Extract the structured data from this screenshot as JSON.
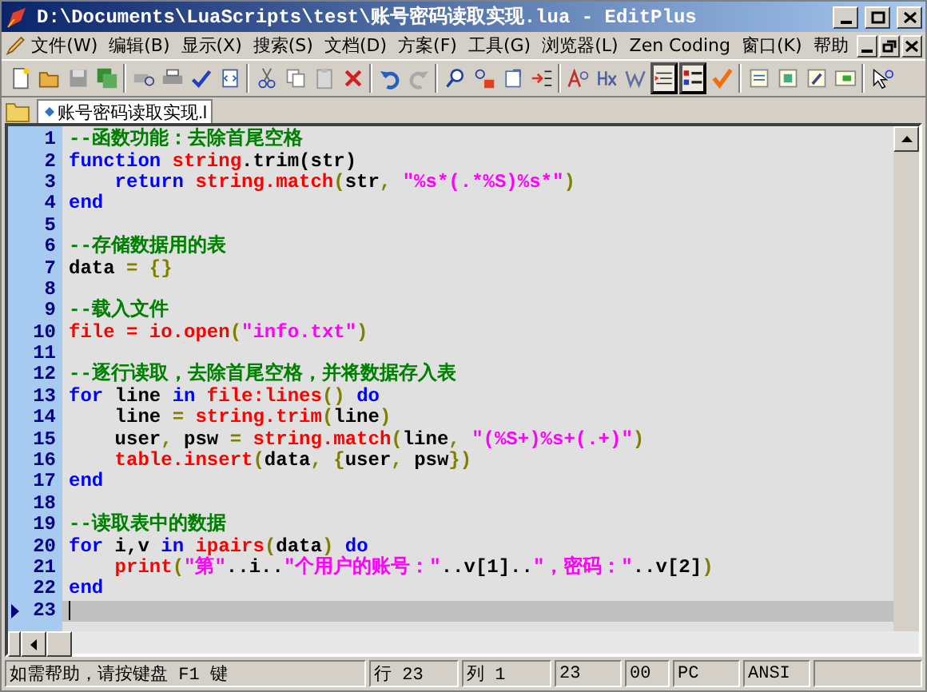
{
  "window": {
    "title": "D:\\Documents\\LuaScripts\\test\\账号密码读取实现.lua - EditPlus"
  },
  "menu": [
    "文件(W)",
    "编辑(B)",
    "显示(X)",
    "搜索(S)",
    "文档(D)",
    "方案(F)",
    "工具(G)",
    "浏览器(L)",
    "Zen Coding",
    "窗口(K)",
    "帮助"
  ],
  "toolbar": [
    {
      "kind": "button",
      "pressed": false
    },
    {
      "kind": "button",
      "pressed": false
    },
    {
      "kind": "button",
      "pressed": false
    },
    {
      "kind": "button",
      "pressed": false
    },
    {
      "kind": "separator"
    },
    {
      "kind": "button",
      "pressed": false
    },
    {
      "kind": "button",
      "pressed": false
    },
    {
      "kind": "button",
      "pressed": false
    },
    {
      "kind": "button",
      "pressed": false
    },
    {
      "kind": "separator"
    },
    {
      "kind": "button",
      "pressed": false
    },
    {
      "kind": "button",
      "pressed": false
    },
    {
      "kind": "button",
      "pressed": false
    },
    {
      "kind": "button",
      "pressed": false
    },
    {
      "kind": "separator"
    },
    {
      "kind": "button",
      "pressed": false
    },
    {
      "kind": "button",
      "pressed": false
    },
    {
      "kind": "separator"
    },
    {
      "kind": "button",
      "pressed": false
    },
    {
      "kind": "button",
      "pressed": false
    },
    {
      "kind": "button",
      "pressed": false
    },
    {
      "kind": "button",
      "pressed": false
    },
    {
      "kind": "separator"
    },
    {
      "kind": "button",
      "pressed": false
    },
    {
      "kind": "button",
      "pressed": false
    },
    {
      "kind": "button",
      "pressed": false
    },
    {
      "kind": "button",
      "pressed": true
    },
    {
      "kind": "button",
      "pressed": true
    },
    {
      "kind": "button",
      "pressed": false
    },
    {
      "kind": "separator"
    },
    {
      "kind": "button",
      "pressed": false
    },
    {
      "kind": "button",
      "pressed": false
    },
    {
      "kind": "button",
      "pressed": false
    },
    {
      "kind": "button",
      "pressed": false
    },
    {
      "kind": "separator"
    },
    {
      "kind": "button",
      "pressed": false
    }
  ],
  "tabs": [
    {
      "label": "账号密码读取实现.l",
      "selected": true
    }
  ],
  "lines": [
    {
      "number": "1",
      "current": false,
      "tokens": [
        {
          "kind": "comment",
          "text": "--函数功能：去除首尾空格"
        }
      ]
    },
    {
      "number": "2",
      "current": false,
      "tokens": [
        {
          "kind": "keyword",
          "text": "function"
        },
        {
          "kind": "func",
          "text": " string"
        },
        {
          "kind": "plain",
          "text": ".trim(str)"
        }
      ]
    },
    {
      "number": "3",
      "current": false,
      "tokens": [
        {
          "kind": "keyword",
          "text": "    return"
        },
        {
          "kind": "func",
          "text": " string.match"
        },
        {
          "kind": "punct",
          "text": "("
        },
        {
          "kind": "plain",
          "text": "str"
        },
        {
          "kind": "punct",
          "text": ", "
        },
        {
          "kind": "string",
          "text": "\"%s*(.*%S)%s*\""
        },
        {
          "kind": "punct",
          "text": ")"
        }
      ]
    },
    {
      "number": "4",
      "current": false,
      "tokens": [
        {
          "kind": "keyword",
          "text": "end"
        }
      ]
    },
    {
      "number": "5",
      "current": false
    },
    {
      "number": "6",
      "current": false,
      "tokens": [
        {
          "kind": "comment",
          "text": "--存储数据用的表"
        }
      ]
    },
    {
      "number": "7",
      "current": false,
      "tokens": [
        {
          "kind": "plain",
          "text": "data "
        },
        {
          "kind": "punct",
          "text": "= {}"
        }
      ]
    },
    {
      "number": "8",
      "current": false
    },
    {
      "number": "9",
      "current": false,
      "tokens": [
        {
          "kind": "comment",
          "text": "--载入文件"
        }
      ]
    },
    {
      "number": "10",
      "current": false,
      "tokens": [
        {
          "kind": "func",
          "text": "file = io.open"
        },
        {
          "kind": "punct",
          "text": "("
        },
        {
          "kind": "string",
          "text": "\"info.txt\""
        },
        {
          "kind": "punct",
          "text": ")"
        }
      ]
    },
    {
      "number": "11",
      "current": false
    },
    {
      "number": "12",
      "current": false,
      "tokens": [
        {
          "kind": "comment",
          "text": "--逐行读取，去除首尾空格，并将数据存入表"
        }
      ]
    },
    {
      "number": "13",
      "current": false,
      "tokens": [
        {
          "kind": "keyword",
          "text": "for"
        },
        {
          "kind": "plain",
          "text": " line "
        },
        {
          "kind": "keyword",
          "text": "in"
        },
        {
          "kind": "func",
          "text": " file:lines"
        },
        {
          "kind": "punct",
          "text": "() "
        },
        {
          "kind": "keyword",
          "text": "do"
        }
      ]
    },
    {
      "number": "14",
      "current": false,
      "tokens": [
        {
          "kind": "plain",
          "text": "    line "
        },
        {
          "kind": "punct",
          "text": "= "
        },
        {
          "kind": "func",
          "text": "string.trim"
        },
        {
          "kind": "punct",
          "text": "("
        },
        {
          "kind": "plain",
          "text": "line"
        },
        {
          "kind": "punct",
          "text": ")"
        }
      ]
    },
    {
      "number": "15",
      "current": false,
      "tokens": [
        {
          "kind": "plain",
          "text": "    user"
        },
        {
          "kind": "punct",
          "text": ", "
        },
        {
          "kind": "plain",
          "text": "psw "
        },
        {
          "kind": "punct",
          "text": "= "
        },
        {
          "kind": "func",
          "text": "string.match"
        },
        {
          "kind": "punct",
          "text": "("
        },
        {
          "kind": "plain",
          "text": "line"
        },
        {
          "kind": "punct",
          "text": ", "
        },
        {
          "kind": "string",
          "text": "\"(%S+)%s+(.+)\""
        },
        {
          "kind": "punct",
          "text": ")"
        }
      ]
    },
    {
      "number": "16",
      "current": false,
      "tokens": [
        {
          "kind": "func",
          "text": "    table.insert"
        },
        {
          "kind": "punct",
          "text": "("
        },
        {
          "kind": "plain",
          "text": "data"
        },
        {
          "kind": "punct",
          "text": ", {"
        },
        {
          "kind": "plain",
          "text": "user"
        },
        {
          "kind": "punct",
          "text": ", "
        },
        {
          "kind": "plain",
          "text": "psw"
        },
        {
          "kind": "punct",
          "text": "})"
        }
      ]
    },
    {
      "number": "17",
      "current": false,
      "tokens": [
        {
          "kind": "keyword",
          "text": "end"
        }
      ]
    },
    {
      "number": "18",
      "current": false
    },
    {
      "number": "19",
      "current": false,
      "tokens": [
        {
          "kind": "comment",
          "text": "--读取表中的数据"
        }
      ]
    },
    {
      "number": "20",
      "current": false,
      "tokens": [
        {
          "kind": "keyword",
          "text": "for"
        },
        {
          "kind": "plain",
          "text": " i,v "
        },
        {
          "kind": "keyword",
          "text": "in"
        },
        {
          "kind": "func",
          "text": " ipairs"
        },
        {
          "kind": "punct",
          "text": "("
        },
        {
          "kind": "plain",
          "text": "data"
        },
        {
          "kind": "punct",
          "text": ") "
        },
        {
          "kind": "keyword",
          "text": "do"
        }
      ]
    },
    {
      "number": "21",
      "current": false,
      "tokens": [
        {
          "kind": "func",
          "text": "    print"
        },
        {
          "kind": "punct",
          "text": "("
        },
        {
          "kind": "string",
          "text": "\"第\""
        },
        {
          "kind": "plain",
          "text": "..i.."
        },
        {
          "kind": "string",
          "text": "\"个用户的账号：\""
        },
        {
          "kind": "plain",
          "text": "..v[1].."
        },
        {
          "kind": "string",
          "text": "\"，密码：\""
        },
        {
          "kind": "plain",
          "text": "..v[2]"
        },
        {
          "kind": "punct",
          "text": ")"
        }
      ]
    },
    {
      "number": "22",
      "current": false,
      "tokens": [
        {
          "kind": "keyword",
          "text": "end"
        }
      ]
    },
    {
      "number": "23",
      "current": true
    }
  ],
  "status_bar": [
    "如需帮助，请按键盘 F1 键",
    "行 23",
    "列 1",
    "23",
    "00",
    "PC",
    "ANSI"
  ]
}
